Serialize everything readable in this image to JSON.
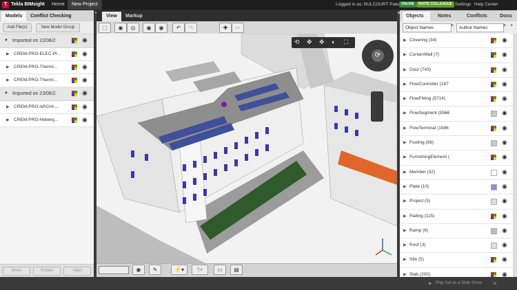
{
  "app": {
    "name": "Tekla BIMsight"
  },
  "topbar": {
    "tabs": [
      "Home",
      "New Project"
    ],
    "logged_in": "Logged in as: BULCOURT Paterne",
    "online": "ONLINE",
    "invite": "INVITE COLLEAGUE",
    "settings": "Settings",
    "help": "Help Center"
  },
  "left": {
    "tabs": [
      "Models",
      "Conflict Checking"
    ],
    "add_files": "Add File(s)",
    "new_group": "New Model Group",
    "groups": [
      {
        "label": "Imported on 22/06/2",
        "items": [
          "CREM-PRO-ELEC-Pl...",
          "CREM-PRO-Thermi...",
          "CREM-PRO-Thermi..."
        ]
      },
      {
        "label": "Imported on 23/06/2",
        "items": [
          "CREM-PRO-ARCHI-...",
          "CREM-PRO-Heberg..."
        ]
      }
    ],
    "bottom": [
      "Move",
      "Rotate",
      "Align"
    ]
  },
  "center": {
    "tabs": [
      "View",
      "Markup"
    ]
  },
  "right": {
    "tabs": [
      "Objects",
      "Notes",
      "Conflicts",
      "Docu"
    ],
    "filter1": "Object Names",
    "filter2": "Author Names",
    "objects": [
      {
        "label": "Covering (34)",
        "color": "multi"
      },
      {
        "label": "CurtainWall (7)",
        "color": "multi"
      },
      {
        "label": "Door (743)",
        "color": "multi"
      },
      {
        "label": "FlowController (167",
        "color": "multi"
      },
      {
        "label": "FlowFitting (5714)",
        "color": "multi"
      },
      {
        "label": "FlowSegment (5566",
        "color": "#c8c8c8"
      },
      {
        "label": "FlowTerminal (1586",
        "color": "multi"
      },
      {
        "label": "Footing (56)",
        "color": "#c8c8c8"
      },
      {
        "label": "FurnishingElement (",
        "color": "multi"
      },
      {
        "label": "Member (32)",
        "color": "#ffffff"
      },
      {
        "label": "Plate (10)",
        "color": "#8e8ed6"
      },
      {
        "label": "Project (5)",
        "color": "#dddddd"
      },
      {
        "label": "Railing (115)",
        "color": "multi"
      },
      {
        "label": "Ramp (6)",
        "color": "#c7b7a8"
      },
      {
        "label": "Roof (3)",
        "color": "#dddddd"
      },
      {
        "label": "Site (5)",
        "color": "multi"
      },
      {
        "label": "Slab (200)",
        "color": "multi"
      }
    ]
  },
  "status": {
    "slideshow": "Play Set as a Slide Show"
  }
}
